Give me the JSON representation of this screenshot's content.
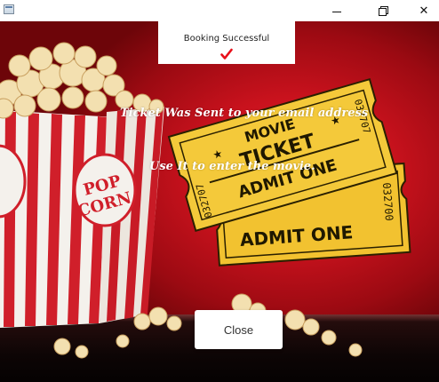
{
  "window": {
    "minimize_glyph": "",
    "maximize_glyph": "",
    "close_glyph": "✕"
  },
  "status": {
    "title": "Booking Successful",
    "icon": "checkmark-icon",
    "icon_color": "#e8101a"
  },
  "messages": {
    "line1": "Ticket Was Sent to your email address",
    "line2": "Use It to enter the movie."
  },
  "tickets": {
    "front": {
      "line1": "MOVIE",
      "line2": "TICKET",
      "line3": "ADMIT ONE",
      "serial": "032707"
    },
    "back": {
      "line1": "ADMIT ONE",
      "serial": "032700"
    }
  },
  "popcorn_box": {
    "label_line1": "POP",
    "label_line2": "CORN"
  },
  "close_button": {
    "label": "Close"
  },
  "colors": {
    "background_red": "#c9121d",
    "ticket_yellow": "#f2c230",
    "stripe_red": "#d01f2a"
  }
}
